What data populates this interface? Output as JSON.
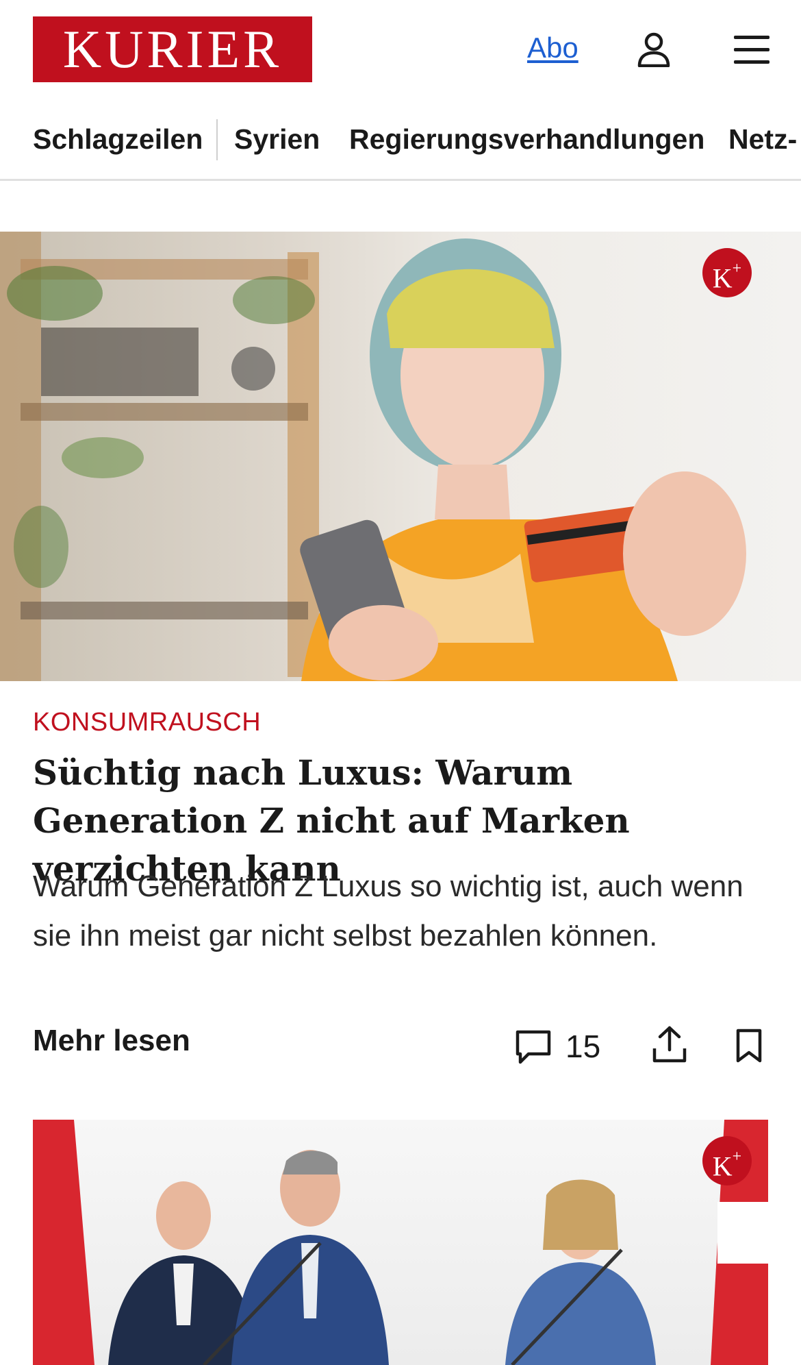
{
  "header": {
    "logo_text": "KURIER",
    "abo_label": "Abo",
    "brand_color": "#c0101e",
    "link_color": "#1d5fd1"
  },
  "nav": {
    "items": [
      {
        "label": "Schlagzeilen"
      },
      {
        "label": "Syrien"
      },
      {
        "label": "Regierungsverhandlungen"
      },
      {
        "label": "Netz-"
      }
    ]
  },
  "article": {
    "premium_badge": "K",
    "premium_badge_plus": "+",
    "kicker": "KONSUMRAUSCH",
    "headline": "Süchtig nach Luxus: Warum Generation Z nicht auf Marken verzichten kann",
    "teaser": "Warum Generation Z Luxus so wichtig ist, auch wenn sie ihn meist gar nicht selbst bezahlen können.",
    "more_label": "Mehr lesen",
    "comment_count": "15",
    "icons": [
      "comment-icon",
      "share-icon",
      "bookmark-icon"
    ]
  },
  "article2": {
    "premium_badge": "K",
    "premium_badge_plus": "+"
  }
}
